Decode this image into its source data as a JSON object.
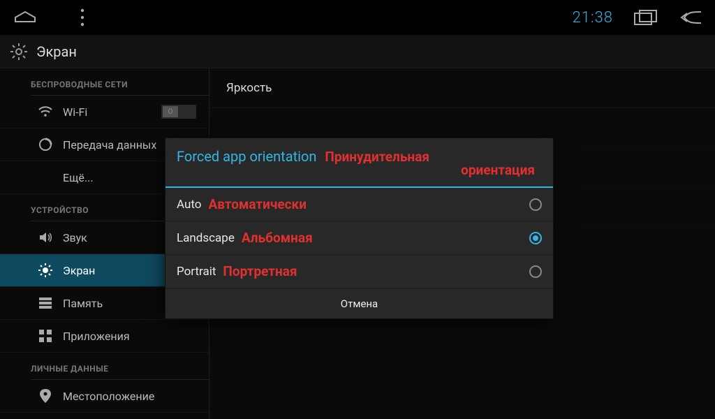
{
  "status": {
    "time": "21:38"
  },
  "appbar": {
    "title": "Экран"
  },
  "sidebar": {
    "section_wireless": "БЕСПРОВОДНЫЕ СЕТИ",
    "wifi": "Wi-Fi",
    "wifi_toggle_state": "O",
    "data_usage": "Передача данных",
    "more": "Ещё...",
    "section_device": "УСТРОЙСТВО",
    "sound": "Звук",
    "display": "Экран",
    "storage": "Память",
    "apps": "Приложения",
    "section_personal": "ЛИЧНЫЕ ДАННЫЕ",
    "location": "Местоположение"
  },
  "content": {
    "brightness": "Яркость"
  },
  "dialog": {
    "title": "Forced app orientation",
    "title_ann_top": "Принудительная",
    "title_ann_bottom": "ориентация",
    "options": {
      "auto": "Auto",
      "auto_ann": "Автоматически",
      "landscape": "Landscape",
      "landscape_ann": "Альбомная",
      "portrait": "Portrait",
      "portrait_ann": "Портретная"
    },
    "selected": "landscape",
    "cancel": "Отмена"
  }
}
